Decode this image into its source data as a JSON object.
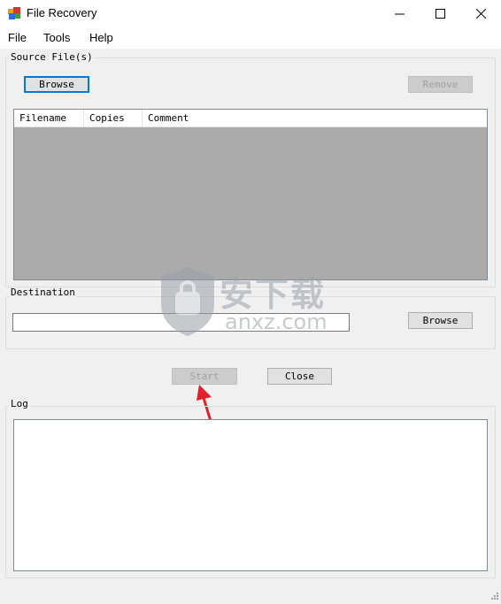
{
  "window": {
    "title": "File Recovery",
    "controls": {
      "minimize": "—",
      "maximize": "☐",
      "close": "✕"
    }
  },
  "menu": [
    "File",
    "Tools",
    "Help"
  ],
  "source": {
    "group_label": "Source File(s)",
    "browse_label": "Browse",
    "remove_label": "Remove",
    "columns": [
      "Filename",
      "Copies",
      "Comment"
    ],
    "rows": []
  },
  "destination": {
    "group_label": "Destination",
    "path_value": "",
    "browse_label": "Browse"
  },
  "actions": {
    "start_label": "Start",
    "close_label": "Close"
  },
  "log": {
    "group_label": "Log",
    "content": ""
  },
  "watermark": {
    "brand": "安下载",
    "domain": "anxz.com"
  },
  "colors": {
    "list_bg": "#ababab",
    "focus": "#0078d7",
    "arrow": "#e0202a"
  },
  "icons": {
    "app": "file-recovery-app-icon",
    "resize": "resize-grip-icon"
  }
}
